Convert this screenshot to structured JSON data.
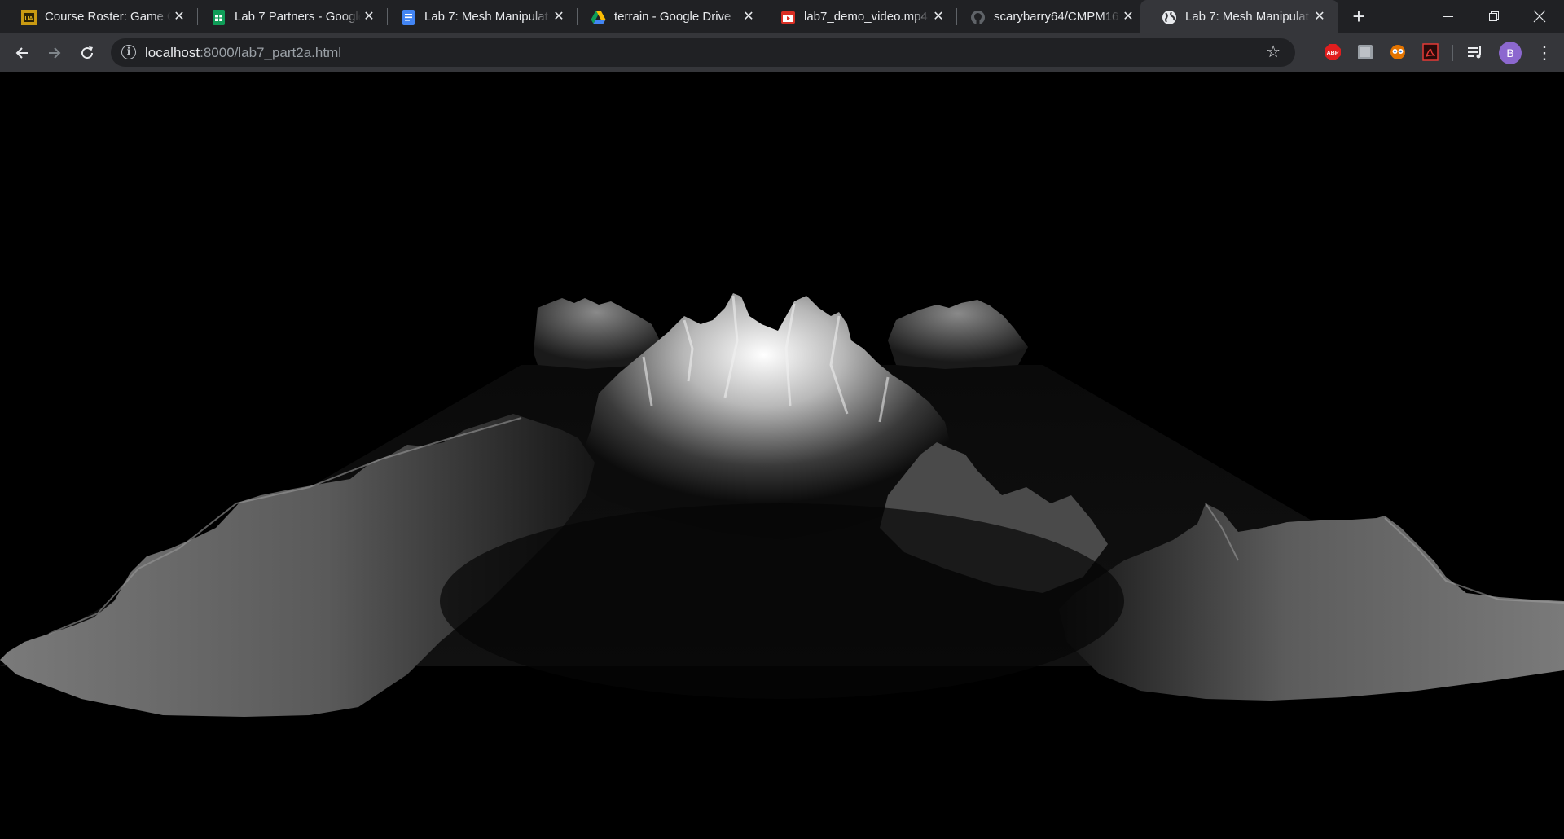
{
  "tabs": [
    {
      "title": "Course Roster: Game G",
      "icon": "course-roster-icon",
      "active": false
    },
    {
      "title": "Lab 7 Partners - Google",
      "icon": "google-sheets-icon",
      "active": false
    },
    {
      "title": "Lab 7: Mesh Manipulat",
      "icon": "google-docs-icon",
      "active": false
    },
    {
      "title": "terrain - Google Drive",
      "icon": "google-drive-icon",
      "active": false
    },
    {
      "title": "lab7_demo_video.mp4",
      "icon": "video-file-icon",
      "active": false
    },
    {
      "title": "scarybarry64/CMPM16",
      "icon": "github-icon",
      "active": false
    },
    {
      "title": "Lab 7: Mesh Manipulat",
      "icon": "globe-icon",
      "active": true
    }
  ],
  "address_bar": {
    "host": "localhost",
    "path": ":8000/lab7_part2a.html"
  },
  "profile": {
    "initial": "B",
    "color": "#8c68cf"
  },
  "extensions": [
    "adblock-icon",
    "extension-square-icon",
    "extension-eyes-icon",
    "pdf-icon"
  ],
  "viewport": {
    "background": "#000000",
    "content": "terrain-heightmap-mesh"
  }
}
